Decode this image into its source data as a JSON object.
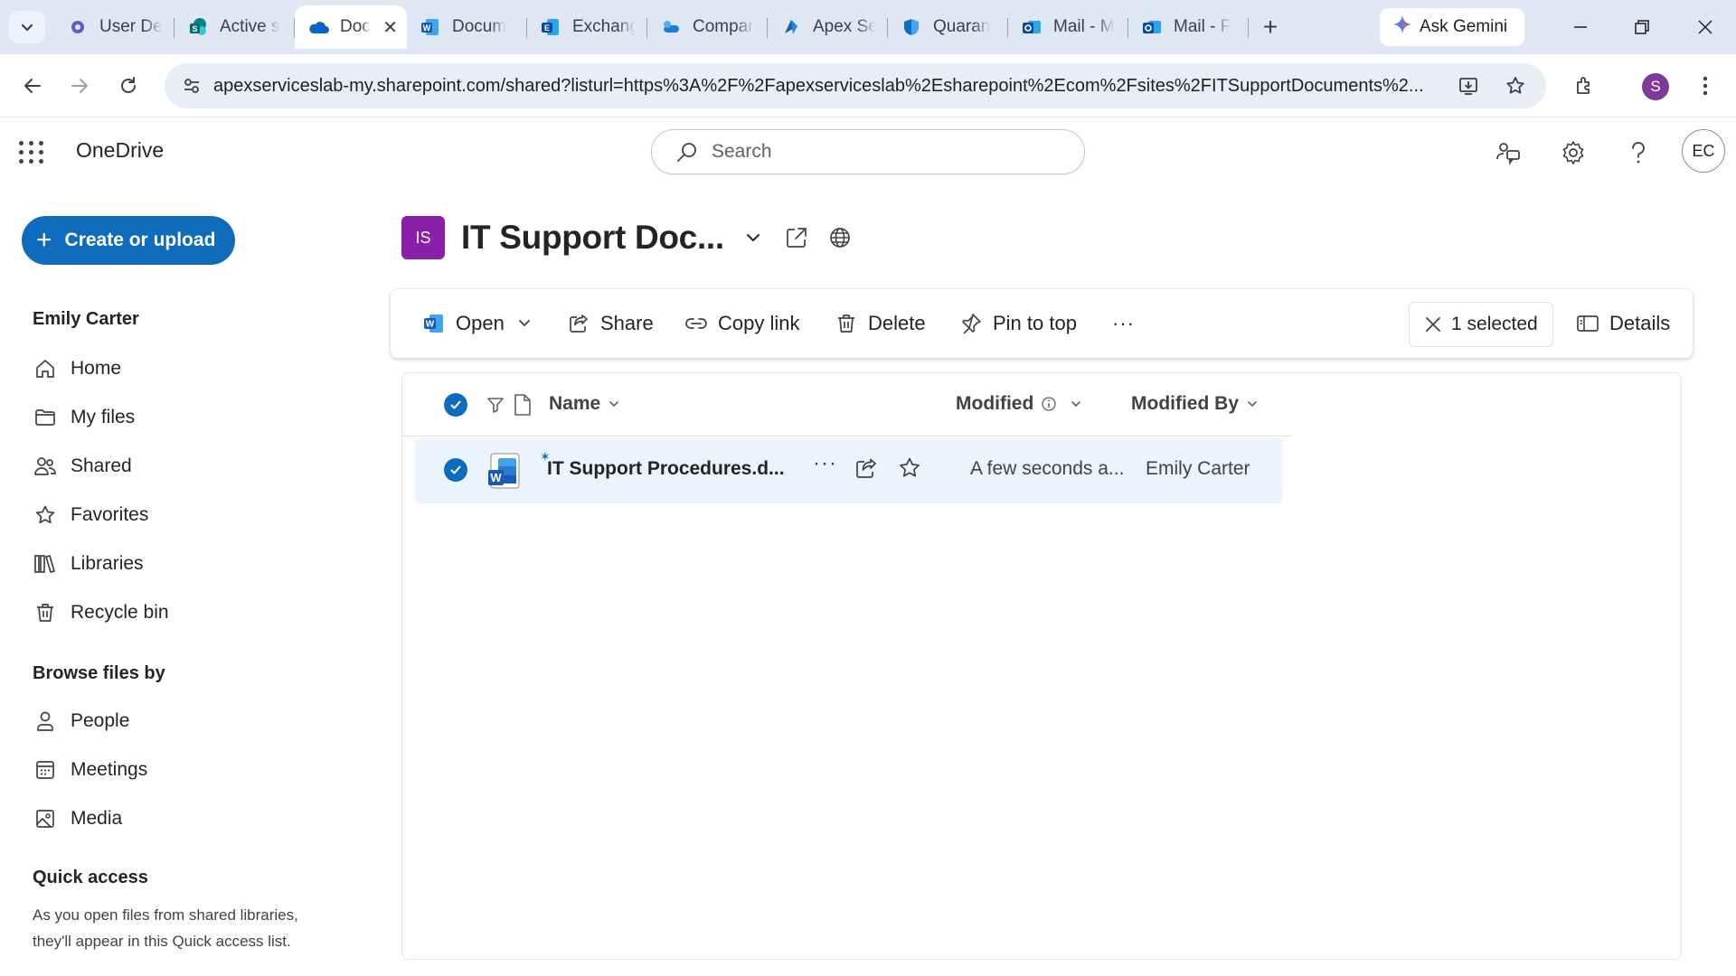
{
  "browser": {
    "tabs": [
      {
        "title": "User De",
        "icon": "gear-icon"
      },
      {
        "title": "Active s",
        "icon": "sharepoint-icon"
      },
      {
        "title": "Doc",
        "icon": "onedrive-icon",
        "active": true
      },
      {
        "title": "Docum",
        "icon": "word-icon"
      },
      {
        "title": "Exchang",
        "icon": "exchange-icon"
      },
      {
        "title": "Compar",
        "icon": "compare-icon"
      },
      {
        "title": "Apex Se",
        "icon": "edge-icon"
      },
      {
        "title": "Quaran",
        "icon": "shield-icon"
      },
      {
        "title": "Mail - M",
        "icon": "outlook-icon"
      },
      {
        "title": "Mail - F",
        "icon": "outlook-icon"
      }
    ],
    "gemini_label": "Ask Gemini",
    "url": "apexserviceslab-my.sharepoint.com/shared?listurl=https%3A%2F%2Fapexserviceslab%2Esharepoint%2Ecom%2Fsites%2FITSupportDocuments%2...",
    "profile_initial": "S",
    "close_tab_glyph": "✕",
    "new_tab_glyph": "+"
  },
  "app": {
    "brand": "OneDrive",
    "search_placeholder": "Search",
    "avatar_initials": "EC"
  },
  "sidebar": {
    "create_label": "Create or upload",
    "user_name": "Emily Carter",
    "items": [
      {
        "label": "Home",
        "icon": "home-icon"
      },
      {
        "label": "My files",
        "icon": "folder-icon"
      },
      {
        "label": "Shared",
        "icon": "people-icon"
      },
      {
        "label": "Favorites",
        "icon": "star-icon"
      },
      {
        "label": "Libraries",
        "icon": "library-icon"
      },
      {
        "label": "Recycle bin",
        "icon": "trash-icon"
      }
    ],
    "browse_title": "Browse files by",
    "browse_items": [
      {
        "label": "People",
        "icon": "person-icon"
      },
      {
        "label": "Meetings",
        "icon": "calendar-icon"
      },
      {
        "label": "Media",
        "icon": "image-icon"
      }
    ],
    "quick_access_title": "Quick access",
    "quick_access_desc": "As you open files from shared libraries, they'll appear in this Quick access list."
  },
  "library": {
    "badge": "IS",
    "title": "IT Support Doc...",
    "badge_color": "#8b1fa9"
  },
  "commands": {
    "open": "Open",
    "share": "Share",
    "copy_link": "Copy link",
    "delete": "Delete",
    "pin": "Pin to top",
    "more": "···",
    "selected": "1 selected",
    "details": "Details"
  },
  "list": {
    "columns": {
      "name": "Name",
      "modified": "Modified",
      "modified_by": "Modified By"
    },
    "rows": [
      {
        "name": "IT Support Procedures.d...",
        "modified": "A few seconds a...",
        "modified_by": "Emily Carter",
        "selected": true
      }
    ],
    "row_more": "···"
  },
  "colors": {
    "accent": "#0f6cbd",
    "selected_row": "#ebf3fc"
  }
}
